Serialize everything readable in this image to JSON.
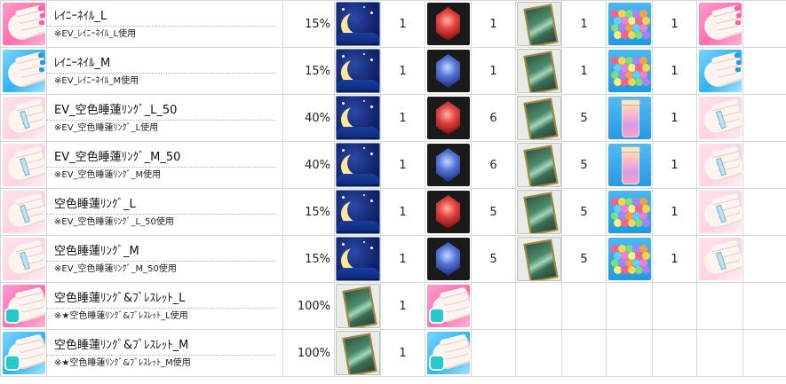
{
  "rows": [
    {
      "icon": "hand-nail-pink-icon",
      "title": "ﾚｲﾆｰﾈｲﾙ_L",
      "sub": "※EV_ﾚｲﾆｰﾈｲﾙ_L使用",
      "rate": "15%",
      "ing1_icon": "moon-icon",
      "ing1_qty": "1",
      "ing2_icon": "red-gem-icon",
      "ing2_qty": "1",
      "ing3_icon": "card-icon",
      "ing3_qty": "1",
      "ing4_icon": "flowers-icon",
      "ing4_qty": "1",
      "result_icon": "hand-nail-pink-icon"
    },
    {
      "icon": "hand-nail-blue-icon",
      "title": "ﾚｲﾆｰﾈｲﾙ_M",
      "sub": "※EV_ﾚｲﾆｰﾈｲﾙ_M使用",
      "rate": "15%",
      "ing1_icon": "moon-icon",
      "ing1_qty": "1",
      "ing2_icon": "blue-gem-icon",
      "ing2_qty": "1",
      "ing3_icon": "card-icon",
      "ing3_qty": "1",
      "ing4_icon": "flowers-icon",
      "ing4_qty": "1",
      "result_icon": "hand-nail-blue-icon"
    },
    {
      "icon": "hand-ring-icon",
      "title": "EV_空色睡蓮ﾘﾝｸﾞ_L_50",
      "sub": "※EV_空色睡蓮ﾘﾝｸﾞ_L使用",
      "rate": "40%",
      "ing1_icon": "moon-icon",
      "ing1_qty": "1",
      "ing2_icon": "red-gem-icon",
      "ing2_qty": "6",
      "ing3_icon": "card-icon",
      "ing3_qty": "5",
      "ing4_icon": "jar-icon",
      "ing4_qty": "1",
      "result_icon": "hand-ring-icon"
    },
    {
      "icon": "hand-ring-icon",
      "title": "EV_空色睡蓮ﾘﾝｸﾞ_M_50",
      "sub": "※EV_空色睡蓮ﾘﾝｸﾞ_M使用",
      "rate": "40%",
      "ing1_icon": "moon-icon",
      "ing1_qty": "1",
      "ing2_icon": "blue-gem-icon",
      "ing2_qty": "6",
      "ing3_icon": "card-icon",
      "ing3_qty": "5",
      "ing4_icon": "jar-icon",
      "ing4_qty": "1",
      "result_icon": "hand-ring-icon"
    },
    {
      "icon": "hand-ring-icon",
      "title": "空色睡蓮ﾘﾝｸﾞ_L",
      "sub": "※EV_空色睡蓮ﾘﾝｸﾞ_L_50使用",
      "rate": "15%",
      "ing1_icon": "moon-icon",
      "ing1_qty": "1",
      "ing2_icon": "red-gem-icon",
      "ing2_qty": "5",
      "ing3_icon": "card-icon",
      "ing3_qty": "5",
      "ing4_icon": "flowers-icon",
      "ing4_qty": "1",
      "result_icon": "hand-ring-icon"
    },
    {
      "icon": "hand-ring-icon",
      "title": "空色睡蓮ﾘﾝｸﾞ_M",
      "sub": "※EV_空色睡蓮ﾘﾝｸﾞ_M_50使用",
      "rate": "15%",
      "ing1_icon": "moon-icon",
      "ing1_qty": "1",
      "ing2_icon": "blue-gem-icon",
      "ing2_qty": "5",
      "ing3_icon": "card-icon",
      "ing3_qty": "5",
      "ing4_icon": "flowers-icon",
      "ing4_qty": "1",
      "result_icon": "hand-ring-icon"
    },
    {
      "icon": "hand-bracelet-pink-icon",
      "title": "空色睡蓮ﾘﾝｸﾞ&ﾌﾞﾚｽﾚｯﾄ_L",
      "sub": "※★空色睡蓮ﾘﾝｸﾞ&ﾌﾞﾚｽﾚｯﾄ_L使用",
      "rate": "100%",
      "ing1_icon": "card-icon",
      "ing1_qty": "1",
      "ing2_icon": "hand-bracelet-pink-icon"
    },
    {
      "icon": "hand-bracelet-blue-icon",
      "title": "空色睡蓮ﾘﾝｸﾞ&ﾌﾞﾚｽﾚｯﾄ_M",
      "sub": "※★空色睡蓮ﾘﾝｸﾞ&ﾌﾞﾚｽﾚｯﾄ_M使用",
      "rate": "100%",
      "ing1_icon": "card-icon",
      "ing1_qty": "1",
      "ing2_icon": "hand-bracelet-blue-icon"
    }
  ]
}
